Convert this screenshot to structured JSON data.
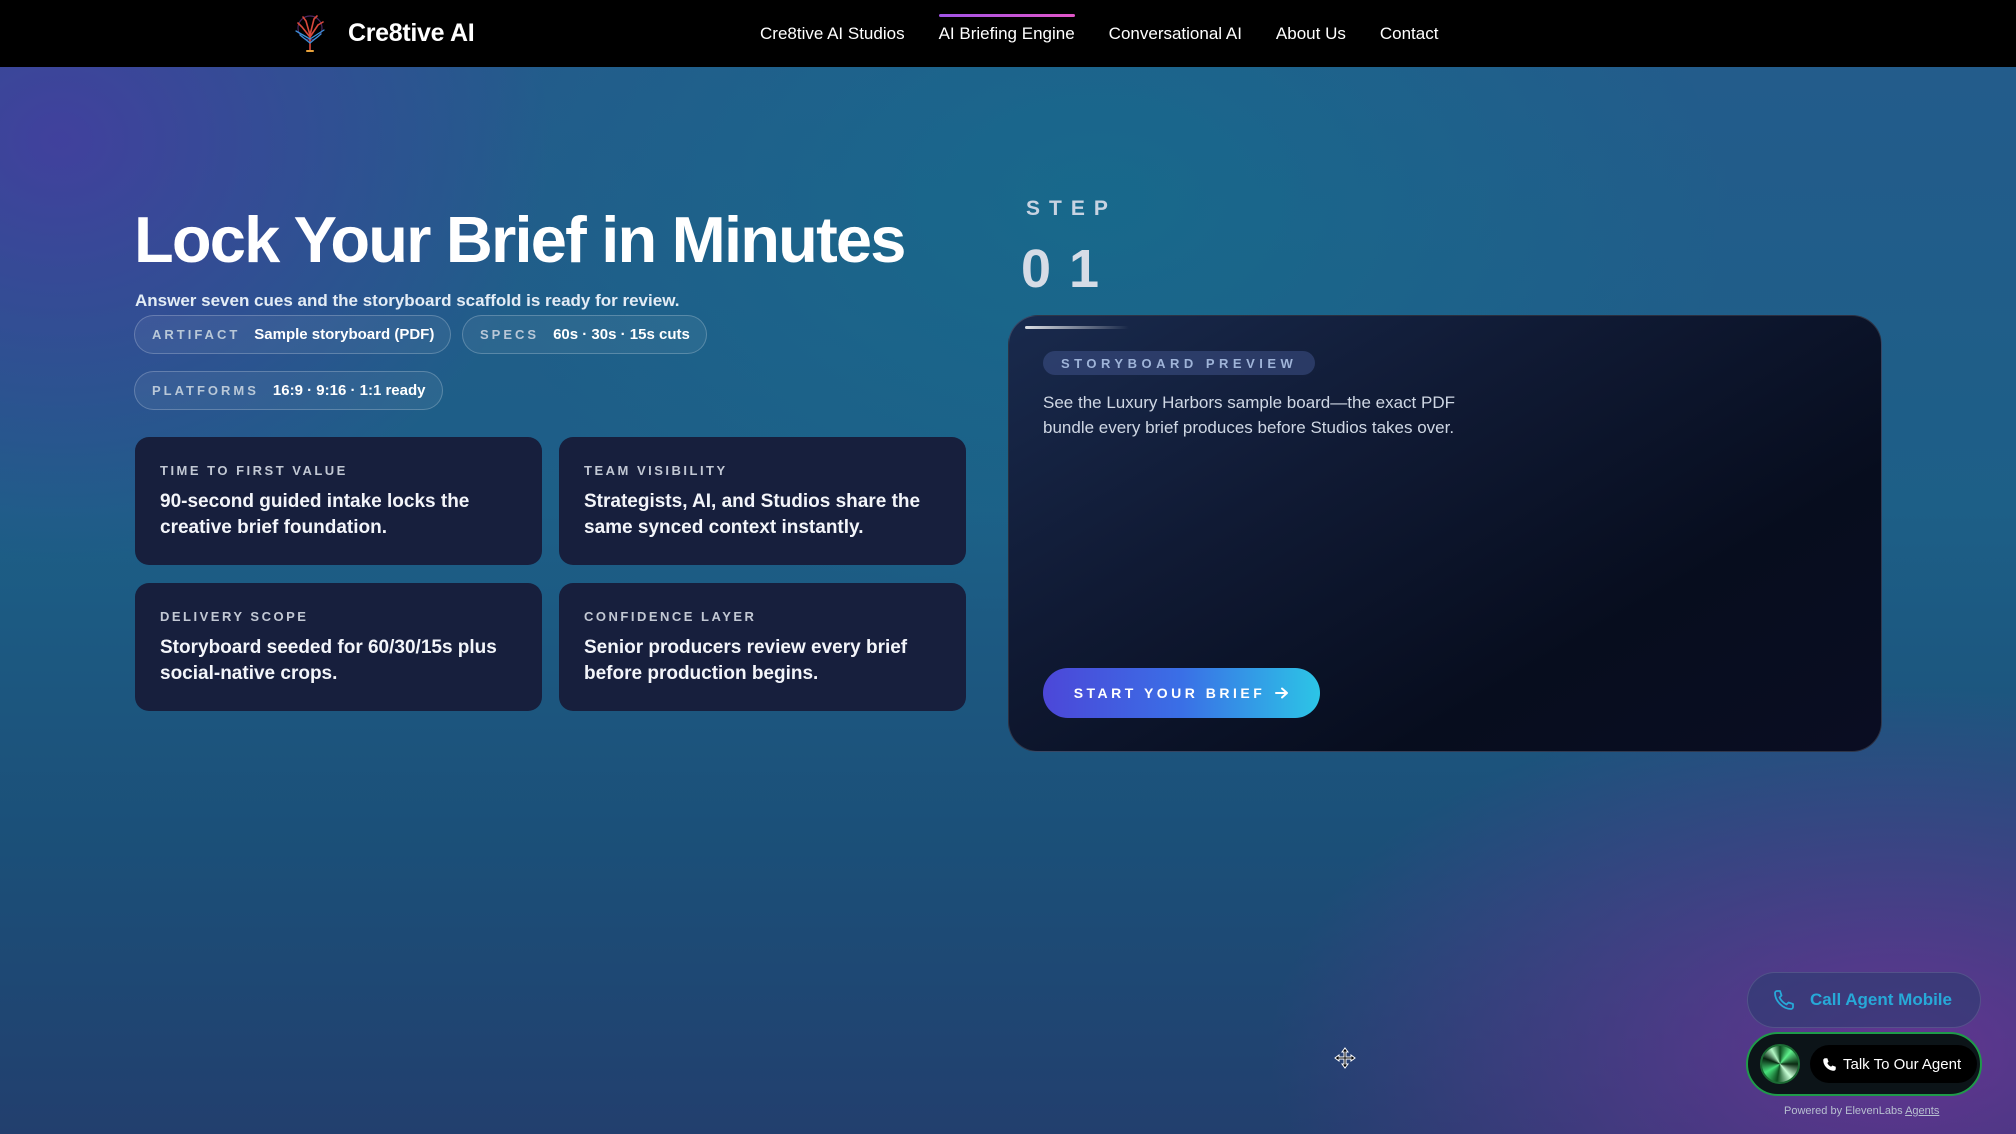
{
  "nav": {
    "brand": "Cre8tive AI",
    "links": [
      {
        "label": "Cre8tive AI Studios"
      },
      {
        "label": "AI Briefing Engine"
      },
      {
        "label": "Conversational AI"
      },
      {
        "label": "About Us"
      },
      {
        "label": "Contact"
      }
    ],
    "active_link": "AI Briefing Engine"
  },
  "hero": {
    "title": "Lock Your Brief in Minutes",
    "subtitle": "Answer seven cues and the storyboard scaffold is ready for review.",
    "pills": [
      {
        "key": "ARTIFACT",
        "value": "Sample storyboard (PDF)"
      },
      {
        "key": "SPECS",
        "value": "60s · 30s · 15s cuts"
      },
      {
        "key": "PLATFORMS",
        "value": "16:9 · 9:16 · 1:1 ready"
      }
    ],
    "cards": [
      {
        "key": "TIME TO FIRST VALUE",
        "value": "90-second guided intake locks the creative brief foundation."
      },
      {
        "key": "TEAM VISIBILITY",
        "value": "Strategists, AI, and Studios share the same synced context instantly."
      },
      {
        "key": "DELIVERY SCOPE",
        "value": "Storyboard seeded for 60/30/15s plus social-native crops."
      },
      {
        "key": "CONFIDENCE LAYER",
        "value": "Senior producers review every brief before production begins."
      }
    ]
  },
  "step": {
    "label": "STEP",
    "number": "01"
  },
  "preview": {
    "tag": "STORYBOARD PREVIEW",
    "description": "See the Luxury Harbors sample board—the exact PDF bundle every brief produces before Studios takes over.",
    "cta_label": "START YOUR BRIEF",
    "cta_icon": "arrow-right-icon"
  },
  "widgets": {
    "call_mobile": "Call Agent Mobile",
    "talk_agent": "Talk To Our Agent",
    "powered_prefix": "Powered by ElevenLabs",
    "powered_link": "Agents"
  },
  "colors": {
    "nav_bg": "#000000",
    "accent_active": "#c056d8",
    "card_bg": "#171f3d",
    "cta_start": "#4c47d8",
    "cta_end": "#2cc5e6",
    "call_text": "#27a9d8",
    "agent_border": "#1f9a4a"
  }
}
